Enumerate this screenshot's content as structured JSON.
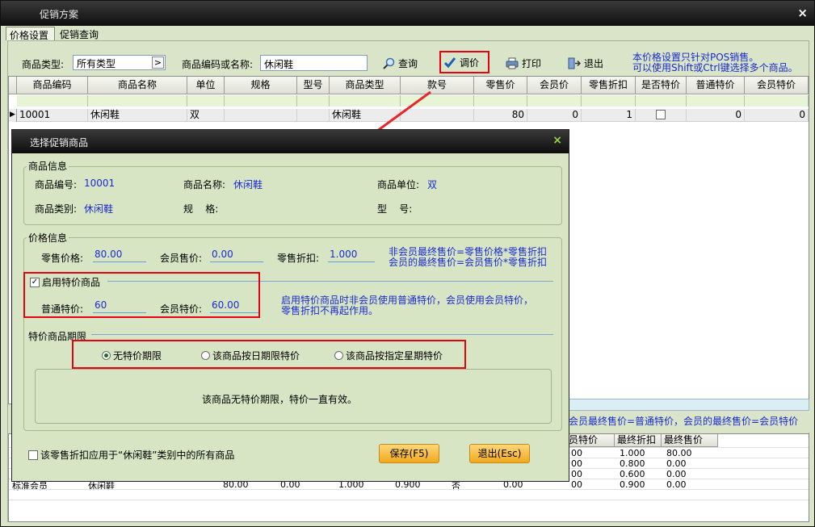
{
  "window": {
    "title": "促销方案",
    "close": "×"
  },
  "tabs": [
    "价格设置",
    "促销查询"
  ],
  "toolbar": {
    "type_label": "商品类型:",
    "type_value": "所有类型",
    "code_label": "商品编码或名称:",
    "code_value": "休闲鞋",
    "query": "查询",
    "adjust": "调价",
    "print": "打印",
    "exit": "退出",
    "note_line1": "本价格设置只针对POS销售。",
    "note_line2": "可以使用Shift或Ctrl键选择多个商品。"
  },
  "grid": {
    "columns": [
      "商品编码",
      "商品名称",
      "单位",
      "规格",
      "型号",
      "商品类型",
      "款号",
      "零售价",
      "会员价",
      "零售折扣",
      "是否特价",
      "普通特价",
      "会员特价"
    ],
    "rows": [
      [
        "10001",
        "休闲鞋",
        "双",
        "",
        "",
        "休闲鞋",
        "",
        "80",
        "0",
        "1",
        "",
        "0",
        "0"
      ]
    ]
  },
  "bottom": {
    "note": "会员最终售价=普通特价，会员的最终售价=会员特价",
    "columns": [
      "员特价",
      "最终折扣",
      "最终售价"
    ],
    "rows": [
      [
        "00",
        "1.000",
        "80.00"
      ],
      [
        "00",
        "0.800",
        "0.00"
      ],
      [
        "00",
        "0.600",
        "0.00"
      ],
      [
        "00",
        "0.900",
        "0.00"
      ]
    ],
    "last_row": [
      "标准会员",
      "休闲鞋",
      "80.00",
      "0.00",
      "1.000",
      "0.900",
      "否",
      "0.00"
    ]
  },
  "dialog": {
    "title": "选择促销商品",
    "close": "×",
    "info_legend": "商品信息",
    "code_label": "商品编号:",
    "code_value": "10001",
    "name_label": "商品名称:",
    "name_value": "休闲鞋",
    "unit_label": "商品单位:",
    "unit_value": "双",
    "cat_label": "商品类别:",
    "cat_value": "休闲鞋",
    "spec_label": "规    格:",
    "model_label": "型    号:",
    "price_legend": "价格信息",
    "retail_label": "零售价格:",
    "retail_value": "80.00",
    "member_label": "会员售价:",
    "member_value": "0.00",
    "discount_label": "零售折扣:",
    "discount_value": "1.000",
    "formula_line1": "非会员最终售价=零售价格*零售折扣",
    "formula_line2": "会员的最终售价=会员售价*零售折扣",
    "special_check": "启用特价商品",
    "normal_special_label": "普通特价:",
    "normal_special_value": "60",
    "member_special_label": "会员特价:",
    "member_special_value": "60.00",
    "special_note_line1": "启用特价商品时非会员使用普通特价，会员使用会员特价，",
    "special_note_line2": "零售折扣不再起作用。",
    "period_legend": "特价商品期限",
    "radio1": "无特价期限",
    "radio2": "该商品按日期限特价",
    "radio3": "该商品按指定星期特价",
    "period_note": "该商品无特价期限，特价一直有效。",
    "apply_check": "该零售折扣应用于“休闲鞋”类别中的所有商品",
    "save": "保存(F5)",
    "exit": "退出(Esc)"
  },
  "colors": {
    "accent_red": "#e60012",
    "link_blue": "#1a2bd0",
    "window_bg": "#d9e4c8"
  }
}
